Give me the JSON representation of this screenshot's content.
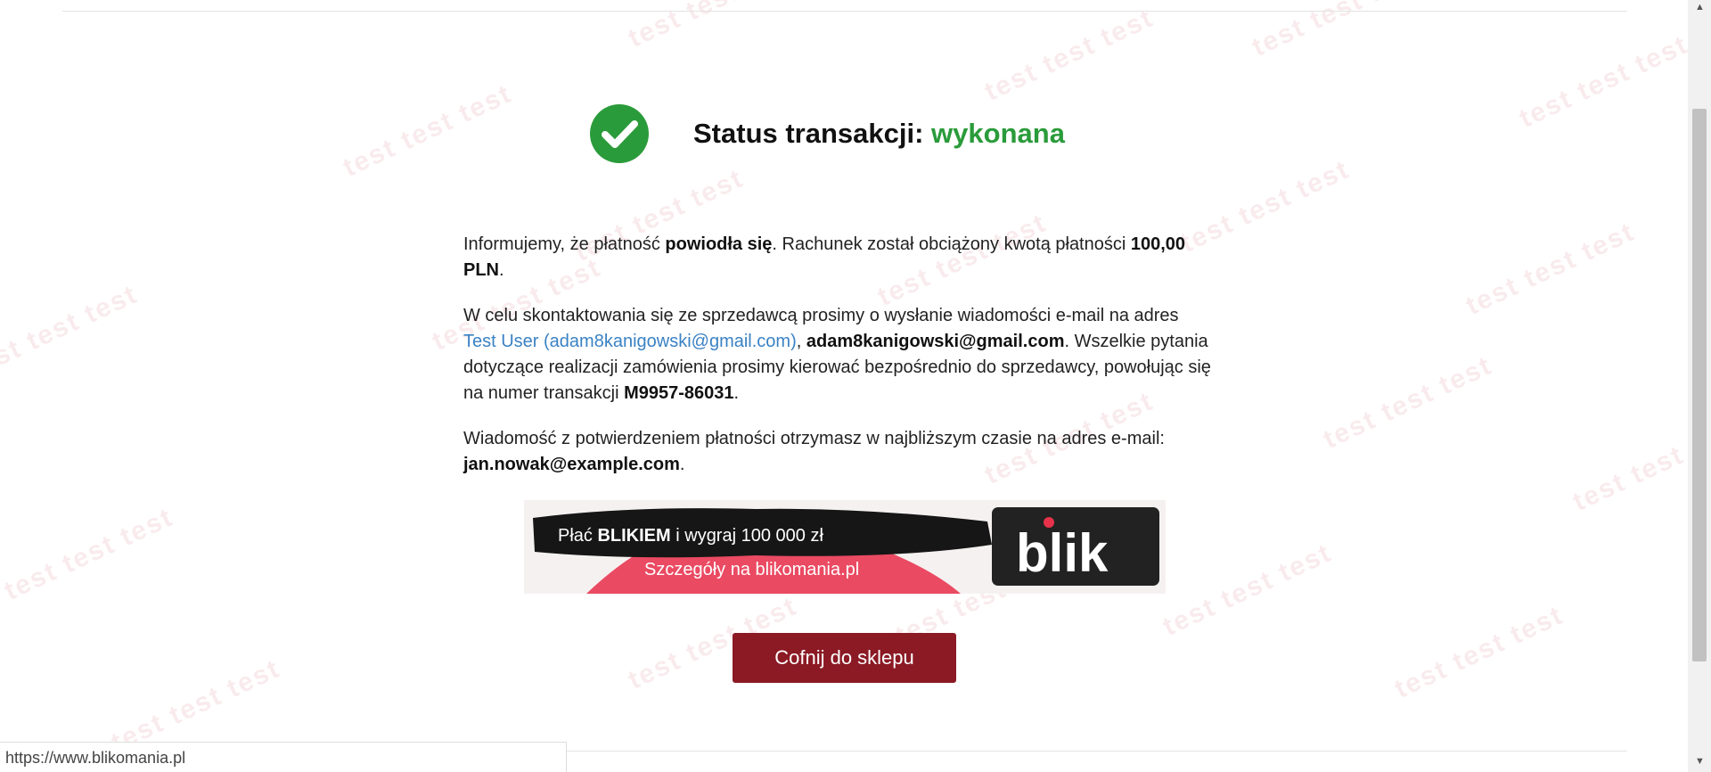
{
  "watermark_text": "test test test",
  "status": {
    "label": "Status transakcji: ",
    "value": "wykonana",
    "icon": "check-circle-icon",
    "color": "#2a9b3a"
  },
  "message": {
    "p1_a": "Informujemy, że płatność ",
    "p1_b": "powiodła się",
    "p1_c": ". Rachunek został obciążony kwotą płatności ",
    "p1_amount": "100,00 PLN",
    "p1_d": ".",
    "p2_a": "W celu skontaktowania się ze sprzedawcą prosimy o wysłanie wiadomości e-mail na adres ",
    "p2_link": "Test User (adam8kanigowski@gmail.com)",
    "p2_b": ", ",
    "p2_email": "adam8kanigowski@gmail.com",
    "p2_c": ". Wszelkie pytania dotyczące realizacji zamówienia prosimy kierować bezpośrednio do sprzedawcy, powołując się na numer transakcji ",
    "p2_txn": "M9957-86031",
    "p2_d": ".",
    "p3_a": "Wiadomość z potwierdzeniem płatności otrzymasz w najbliższym czasie na adres e-mail: ",
    "p3_email": "jan.nowak@example.com",
    "p3_b": "."
  },
  "banner": {
    "line1_a": "Płać ",
    "line1_b": "BLIKIEM",
    "line1_c": " i wygraj 100 000 zł",
    "line2": "Szczegóły na blikomania.pl",
    "logo_b": "b",
    "logo_l": "l",
    "logo_ik": "ik"
  },
  "back_button": "Cofnij do sklepu",
  "status_bar_url": "https://www.blikomania.pl",
  "colors": {
    "success": "#2a9b3a",
    "button": "#8b1a25",
    "link": "#3a82c4"
  }
}
